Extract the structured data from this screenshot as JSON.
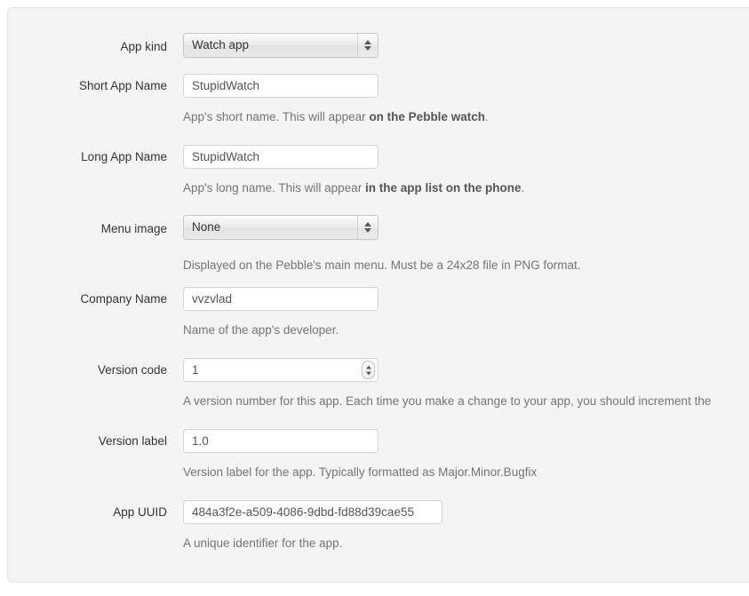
{
  "form": {
    "fields": [
      {
        "label": "App kind",
        "type": "select",
        "value": "Watch app",
        "icon": "select-arrows-icon",
        "help": null
      },
      {
        "label": "Short App Name",
        "type": "text",
        "value": "StupidWatch",
        "help_prefix": "App's short name. This will appear ",
        "help_bold": "on the Pebble watch",
        "help_suffix": "."
      },
      {
        "label": "Long App Name",
        "type": "text",
        "value": "StupidWatch",
        "help_prefix": "App's long name. This will appear ",
        "help_bold": "in the app list on the phone",
        "help_suffix": "."
      },
      {
        "label": "Menu image",
        "type": "select",
        "value": "None",
        "icon": "select-arrows-icon",
        "help_prefix": "Displayed on the Pebble's main menu. Must be a 24x28 file in PNG format.",
        "help_bold": "",
        "help_suffix": ""
      },
      {
        "label": "Company Name",
        "type": "text",
        "value": "vvzvlad",
        "help_prefix": "Name of the app's developer.",
        "help_bold": "",
        "help_suffix": ""
      },
      {
        "label": "Version code",
        "type": "number",
        "value": "1",
        "icon": "stepper-arrows-icon",
        "help_prefix": "A version number for this app. Each time you make a change to your app, you should increment the",
        "help_bold": "",
        "help_suffix": ""
      },
      {
        "label": "Version label",
        "type": "text",
        "value": "1.0",
        "help_prefix": "Version label for the app. Typically formatted as Major.Minor.Bugfix",
        "help_bold": "",
        "help_suffix": ""
      },
      {
        "label": "App UUID",
        "type": "text",
        "value": "484a3f2e-a509-4086-9dbd-fd88d39cae55",
        "help_prefix": "A unique identifier for the app.",
        "help_bold": "",
        "help_suffix": ""
      }
    ]
  },
  "colors": {
    "panel_bg": "#f4f4f4",
    "panel_border": "#e3e3e3",
    "input_bg": "#ffffff",
    "input_border": "#d5d5d5",
    "label_text": "#333333",
    "help_text": "#757575",
    "help_bold_text": "#555555"
  }
}
